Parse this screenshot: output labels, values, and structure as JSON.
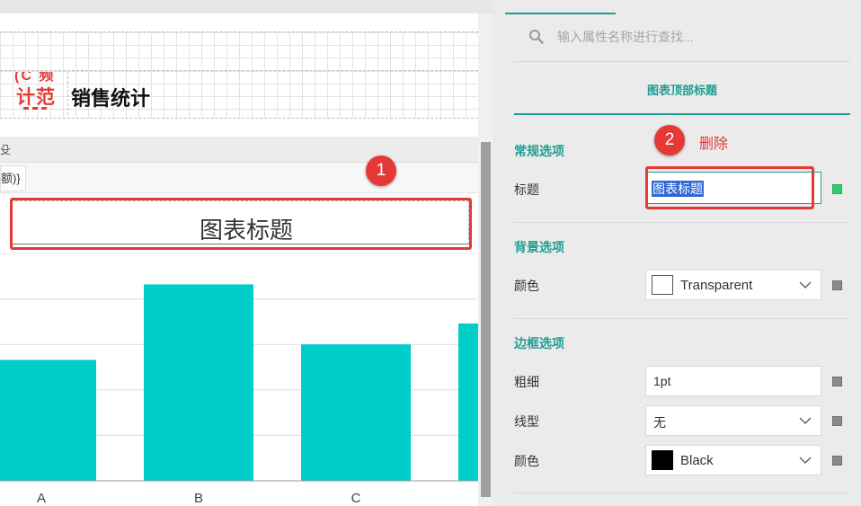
{
  "report": {
    "logo_text_top": "(C 频",
    "logo_text_main": "计范",
    "title": "销售统计",
    "band_label": "殳",
    "field_expression": "额)}"
  },
  "chart": {
    "title": "图表标题"
  },
  "chart_data": {
    "type": "bar",
    "categories": [
      "A",
      "B",
      "C",
      ""
    ],
    "values": [
      133,
      216,
      150,
      173
    ],
    "color": "#00cec9",
    "grid": true,
    "ylim": [
      0,
      250
    ],
    "title": "图表标题",
    "xlabel": "",
    "ylabel": ""
  },
  "annotations": {
    "badge_1": "1",
    "badge_2": "2",
    "delete_note": "删除",
    "highlight_color": "#e53935"
  },
  "panel": {
    "search": {
      "placeholder": "输入属性名称进行查找..."
    },
    "section_tab": "图表顶部标题",
    "general": {
      "title": "常规选项",
      "title_label": "标题",
      "title_value": "图表标题",
      "indicator_color": "#2ecc71"
    },
    "background": {
      "title": "背景选项",
      "color_label": "颜色",
      "color_value": "Transparent",
      "swatch_color": "#ffffff"
    },
    "border": {
      "title": "边框选项",
      "width_label": "粗细",
      "width_value": "1pt",
      "style_label": "线型",
      "style_value": "无",
      "color_label": "颜色",
      "color_value": "Black",
      "swatch_color": "#000000"
    },
    "accent_color": "#1f9d94"
  }
}
